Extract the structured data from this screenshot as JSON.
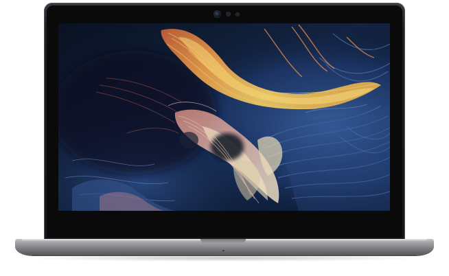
{
  "image": {
    "subject": "laptop",
    "wallpaper": {
      "palette": {
        "deep_blue": "#0b1830",
        "mid_blue": "#2c4d86",
        "steel_blue": "#5b7fb6",
        "orange": "#e8894a",
        "gold": "#f2c15a",
        "pink": "#e3a7a1",
        "cream": "#f3e2c2"
      }
    },
    "chassis_colors": {
      "lid": "#1f2024",
      "bezel": "#0a0a0b",
      "base": "#8b8c90"
    }
  }
}
